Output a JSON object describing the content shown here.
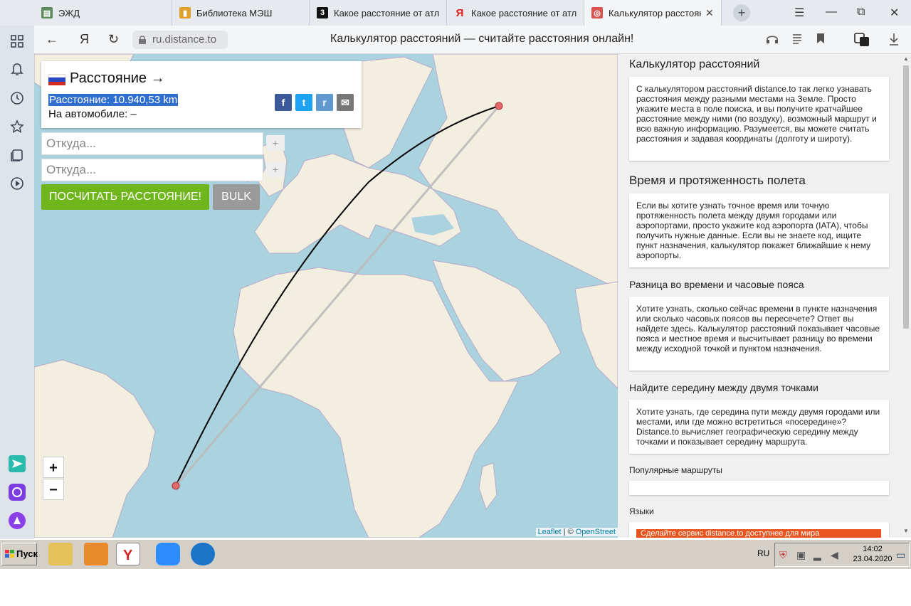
{
  "tabs": [
    {
      "title": "ЭЖД",
      "fav_color": "#5c8a5c",
      "fav_glyph": "▤"
    },
    {
      "title": "Библиотека МЭШ",
      "fav_color": "#e0a030",
      "fav_glyph": "▮"
    },
    {
      "title": "Какое расстояние от атл",
      "fav_color": "#111111",
      "fav_glyph": "3"
    },
    {
      "title": "Какое расстояние от атл",
      "fav_color": "#ffffff",
      "fav_glyph": "Я"
    },
    {
      "title": "Калькулятор расстоян",
      "fav_color": "#d9534f",
      "fav_glyph": "◎",
      "close": "✕"
    }
  ],
  "newtab": "+",
  "window_controls": {
    "menu": "☰",
    "minimize": "—",
    "restore": "⧉",
    "close": "✕"
  },
  "sidebar_icons": [
    "grid-icon",
    "bell-icon",
    "clock-icon",
    "star-icon",
    "collections-icon",
    "play-icon",
    "send-icon",
    "stack-icon",
    "alice-icon"
  ],
  "address": {
    "back": "←",
    "yandex": "Я",
    "reload": "↻",
    "url": "ru.distance.to",
    "title": "Калькулятор расстояний — считайте расстояния онлайн!"
  },
  "map": {
    "title": "Расстояние",
    "arrow": "→",
    "distance": "Расстояние: 10.940,53 km",
    "by_car": "На автомобиле: –",
    "share": [
      {
        "glyph": "f",
        "color": "#3b5998"
      },
      {
        "glyph": "t",
        "color": "#1da1f2"
      },
      {
        "glyph": "r",
        "color": "#5f99cf"
      },
      {
        "glyph": "✉",
        "color": "#777777"
      }
    ],
    "from_placeholder": "Откуда...",
    "to_placeholder": "Откуда...",
    "add": "+",
    "calc_button": "ПОСЧИТАТЬ РАССТОЯНИЕ!",
    "bulk_button": "BULK",
    "zoom_in": "+",
    "zoom_out": "−",
    "attribution_leaflet": "Leaflet",
    "attribution_sep": " | © ",
    "attribution_osm": "OpenStreet"
  },
  "panel": {
    "h1": "Калькулятор расстояний",
    "p1": "С калькулятором расстояний distance.to так легко узнавать расстояния между разными местами на Земле. Просто укажите места в поле поиска, и вы получите кратчайшее расстояние между ними (по воздуху), возможный маршрут и всю важную информацию. Разумеется, вы можете считать расстояния и задавая координаты (долготу и широту).",
    "h2": "Время и протяженность полета",
    "p2": "Если вы хотите узнать точное время или точную протяженность полета между двумя городами или аэропортами, просто укажите код аэропорта (IATA), чтобы получить нужные данные. Если вы не знаете код, ищите пункт назначения, калькулятор покажет ближайшие к нему аэропорты.",
    "h3": "Разница во времени и часовые пояса",
    "p3": "Хотите узнать, сколько сейчас времени в пункте назначения или сколько часовых поясов вы пересечете? Ответ вы найдете здесь. Калькулятор расстояний показывает часовые пояса и местное время и высчитывает разницу во времени между исходной точкой и пунктом назначения.",
    "h4": "Найдите середину между двумя точками",
    "p4": "Хотите узнать, где середина пути между двумя городами или местами, или где можно встретиться «посередине»? Distance.to вычисляет географическую середину между точками и показывает середину маршрута.",
    "h5": "Популярные маршруты",
    "h6": "Языки",
    "promo": "Сделайте сервис distance.to доступнее для мира"
  },
  "taskbar": {
    "start": "Пуск",
    "lang": "RU",
    "time": "14:02",
    "date": "23.04.2020"
  }
}
